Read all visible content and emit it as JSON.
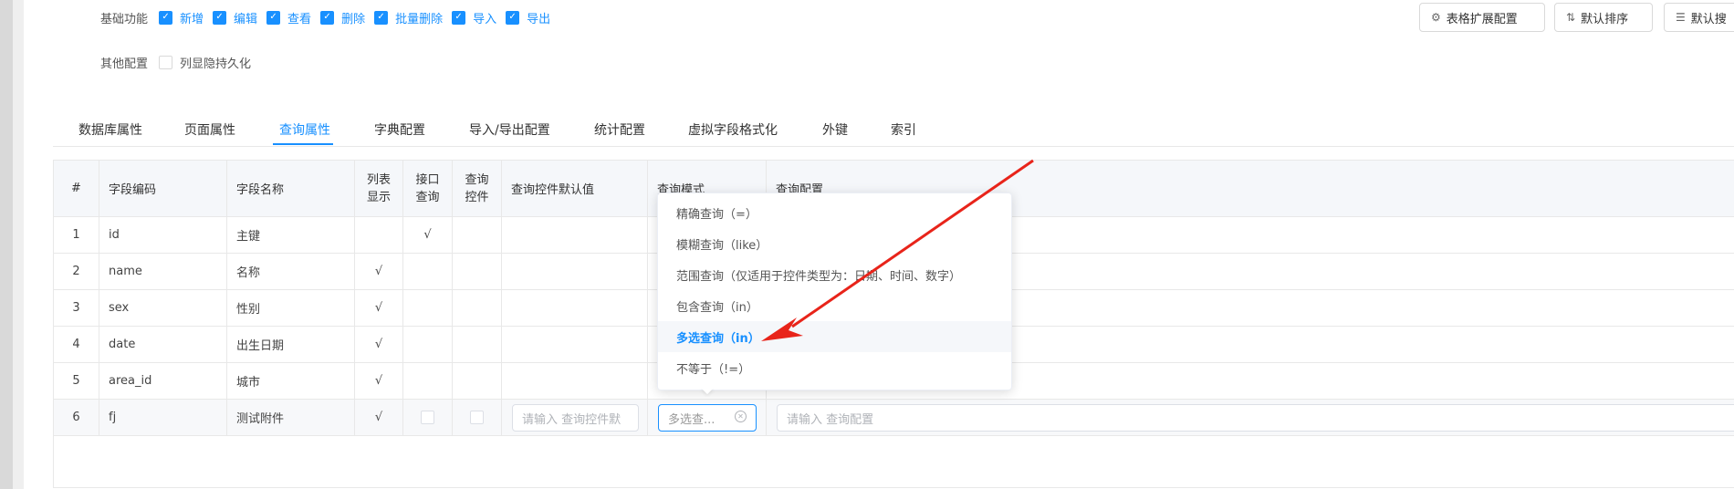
{
  "form": {
    "basic_label": "基础功能",
    "basic_options": [
      {
        "label": "新增",
        "checked": true
      },
      {
        "label": "编辑",
        "checked": true
      },
      {
        "label": "查看",
        "checked": true
      },
      {
        "label": "删除",
        "checked": true
      },
      {
        "label": "批量删除",
        "checked": true
      },
      {
        "label": "导入",
        "checked": true
      },
      {
        "label": "导出",
        "checked": true
      }
    ],
    "other_label": "其他配置",
    "other_option": {
      "label": "列显隐持久化",
      "checked": false
    }
  },
  "toolbar": {
    "ext_config": "表格扩展配置",
    "default_sort": "默认排序",
    "default_search": "默认搜"
  },
  "tabs": [
    "数据库属性",
    "页面属性",
    "查询属性",
    "字典配置",
    "导入/导出配置",
    "统计配置",
    "虚拟字段格式化",
    "外键",
    "索引"
  ],
  "active_tab": "查询属性",
  "table": {
    "headers": {
      "idx": "#",
      "code": "字段编码",
      "name": "字段名称",
      "list_show": "列表\n显示",
      "api_query": "接口\n查询",
      "query_ctrl": "查询\n控件",
      "default_val": "查询控件默认值",
      "query_mode": "查询模式",
      "query_config": "查询配置"
    },
    "rows": [
      {
        "idx": "1",
        "code": "id",
        "name": "主键",
        "list_show": "",
        "api_query": "√"
      },
      {
        "idx": "2",
        "code": "name",
        "name": "名称",
        "list_show": "√",
        "api_query": ""
      },
      {
        "idx": "3",
        "code": "sex",
        "name": "性别",
        "list_show": "√",
        "api_query": ""
      },
      {
        "idx": "4",
        "code": "date",
        "name": "出生日期",
        "list_show": "√",
        "api_query": ""
      },
      {
        "idx": "5",
        "code": "area_id",
        "name": "城市",
        "list_show": "√",
        "api_query": ""
      },
      {
        "idx": "6",
        "code": "fj",
        "name": "测试附件",
        "list_show": "√",
        "api_query": ""
      }
    ],
    "edit_row": {
      "default_placeholder": "请输入 查询控件默",
      "mode_value": "多选查...",
      "config_placeholder": "请输入 查询配置"
    }
  },
  "dropdown": {
    "options": [
      "精确查询（=）",
      "模糊查询（like）",
      "范围查询（仅适用于控件类型为：日期、时间、数字）",
      "包含查询（in）",
      "多选查询（in）",
      "不等于（!=）"
    ],
    "selected_index": 4
  },
  "colors": {
    "accent": "#1890ff",
    "arrow": "#e8241a",
    "header_bg": "#f5f7fa"
  }
}
